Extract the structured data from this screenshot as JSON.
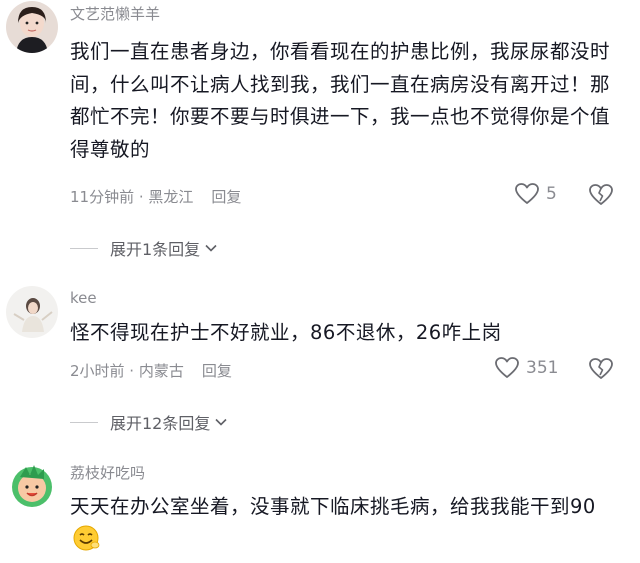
{
  "comments": [
    {
      "username": "文艺范懒羊羊",
      "content": "我们一直在患者身边，你看看现在的护患比例，我尿尿都没时间，什么叫不让病人找到我，我们一直在病房没有离开过！那都忙不完！你要不要与时俱进一下，我一点也不觉得你是个值得尊敬的",
      "meta": "11分钟前 · 黑龙江",
      "reply_label": "回复",
      "likes": "5",
      "expand_label": "展开1条回复"
    },
    {
      "username": "kee",
      "content": "怪不得现在护士不好就业，86不退休，26咋上岗",
      "meta": "2小时前 · 内蒙古",
      "reply_label": "回复",
      "likes": "351",
      "expand_label": "展开12条回复"
    },
    {
      "username": "荔枝好吃吗",
      "content": "天天在办公室坐着，没事就下临床挑毛病，给我我能干到90",
      "emoji": "smiling-face-emoji"
    }
  ],
  "icons": {
    "like": "heart-outline-icon",
    "dislike": "broken-heart-icon",
    "expand": "chevron-down-icon"
  },
  "colors": {
    "text": "#161823",
    "secondary": "#8a8b91",
    "divider": "#c9cacd"
  }
}
